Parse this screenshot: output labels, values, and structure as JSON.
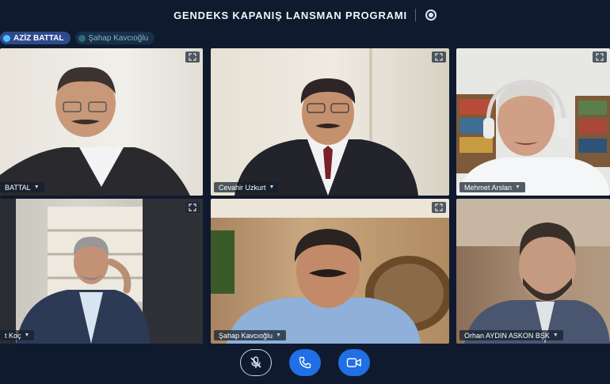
{
  "meeting": {
    "title": "GENDEKS KAPANIŞ LANSMAN PROGRAMI"
  },
  "chips": [
    {
      "label": "AZİZ BATTAL",
      "state": "active"
    },
    {
      "label": "Şahap Kavcıoğlu",
      "state": "passive"
    }
  ],
  "participants": [
    {
      "name": "BATTAL"
    },
    {
      "name": "Cevahir Uzkurt"
    },
    {
      "name": "Mehmet Arslan"
    },
    {
      "name": "t Koç"
    },
    {
      "name": "Şahap Kavcıoğlu"
    },
    {
      "name": "Orhan AYDIN ASKON BŞK"
    }
  ],
  "controls": {
    "icons": [
      "microphone-muted-icon",
      "phone-icon",
      "video-camera-icon"
    ]
  },
  "colors": {
    "background": "#0f1a2e",
    "accent": "#1f6fe5",
    "active_chip": "#2c4a8c"
  }
}
